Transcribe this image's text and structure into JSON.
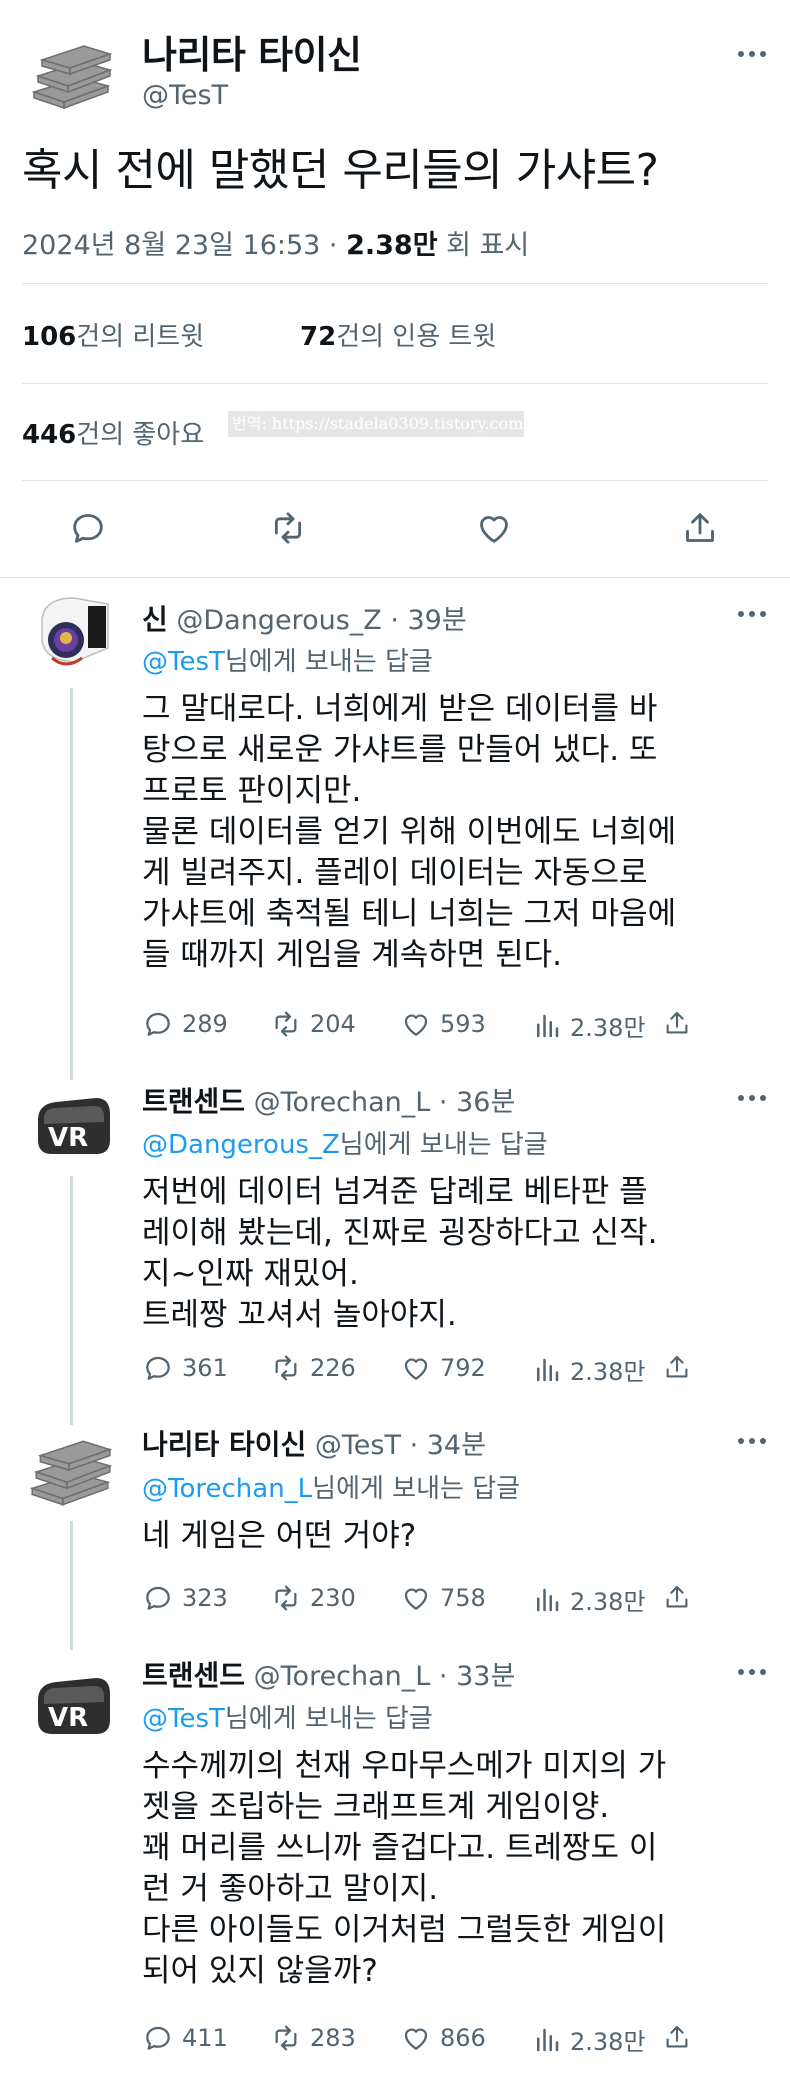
{
  "main_tweet": {
    "author_name": "나리타 타이신",
    "author_handle": "@TesT",
    "text": "혹시 전에 말했던 우리들의 가샤트?",
    "date": "2024년 8월 23일 16:53 · ",
    "views": "2.38만",
    "views_label": " 회 표시",
    "retweets_count": "106",
    "retweets_label": "건의 리트윗",
    "quotes_count": "72",
    "quotes_label": "건의 인용 트윗",
    "likes_count": "446",
    "likes_label": "건의 좋아요",
    "watermark": "번역: https://stadela0309.tistory.com"
  },
  "replies": [
    {
      "name": "신",
      "handle": "@Dangerous_Z · 39분",
      "reply_to": "@TesT",
      "reply_suffix": "님에게 보내는 답글",
      "lines": [
        "그 말대로다. 너희에게 받은 데이터를 바",
        "탕으로 새로운 가샤트를 만들어 냈다. 또",
        "프로토 판이지만.",
        "물론 데이터를 얻기 위해 이번에도 너희에",
        "게 빌려주지. 플레이 데이터는 자동으로",
        "가샤트에 축적될 테니 너희는 그저 마음에",
        "들 때까지 게임을 계속하면 된다."
      ],
      "replies": "289",
      "retweets": "204",
      "likes": "593",
      "views": "2.38만"
    },
    {
      "name": "트랜센드",
      "handle": "@Torechan_L · 36분",
      "reply_to": "@Dangerous_Z",
      "reply_suffix": "님에게 보내는 답글",
      "lines": [
        "저번에 데이터 넘겨준 답례로 베타판 플",
        "레이해 봤는데, 진짜로 굉장하다고 신작.",
        "지~인짜 재밌어.",
        "트레짱 꼬셔서 놀아야지."
      ],
      "replies": "361",
      "retweets": "226",
      "likes": "792",
      "views": "2.38만"
    },
    {
      "name": "나리타 타이신",
      "handle": "@TesT · 34분",
      "reply_to": "@Torechan_L",
      "reply_suffix": "님에게 보내는 답글",
      "lines": [
        "네 게임은 어떤 거야?"
      ],
      "replies": "323",
      "retweets": "230",
      "likes": "758",
      "views": "2.38만"
    },
    {
      "name": "트랜센드",
      "handle": "@Torechan_L · 33분",
      "reply_to": "@TesT",
      "reply_suffix": "님에게 보내는 답글",
      "lines": [
        "수수께끼의 천재 우마무스메가 미지의 가",
        "젯을 조립하는 크래프트계 게임이양.",
        "꽤 머리를 쓰니까 즐겁다고. 트레짱도 이",
        "런 거 좋아하고 말이지.",
        "다른 아이들도 이거처럼 그럴듯한 게임이",
        "되어 있지 않을까?"
      ],
      "replies": "411",
      "retweets": "283",
      "likes": "866",
      "views": "2.38만"
    }
  ],
  "colors": {
    "text": "#0f1419",
    "secondary": "#536471",
    "link": "#1d9bf0",
    "divider": "#e1e6ea"
  }
}
